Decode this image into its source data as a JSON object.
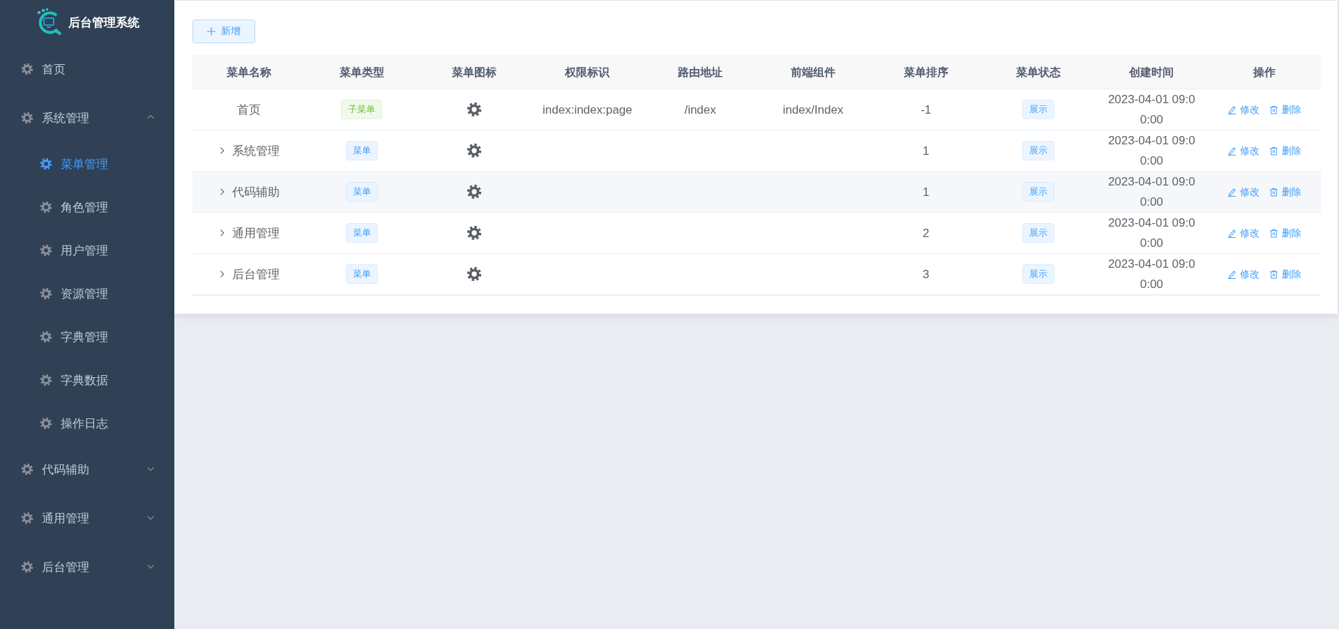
{
  "sidebar": {
    "title": "后台管理系统",
    "items": [
      {
        "label": "首页",
        "selected": false
      },
      {
        "label": "系统管理",
        "selected": false,
        "expanded": true,
        "children": [
          {
            "label": "菜单管理",
            "selected": true
          },
          {
            "label": "角色管理",
            "selected": false
          },
          {
            "label": "用户管理",
            "selected": false
          },
          {
            "label": "资源管理",
            "selected": false
          },
          {
            "label": "字典管理",
            "selected": false
          },
          {
            "label": "字典数据",
            "selected": false
          },
          {
            "label": "操作日志",
            "selected": false
          }
        ]
      },
      {
        "label": "代码辅助",
        "selected": false,
        "expanded": false
      },
      {
        "label": "通用管理",
        "selected": false,
        "expanded": false
      },
      {
        "label": "后台管理",
        "selected": false,
        "expanded": false
      }
    ]
  },
  "add_button": {
    "label": "新增"
  },
  "table": {
    "columns": [
      "菜单名称",
      "菜单类型",
      "菜单图标",
      "权限标识",
      "路由地址",
      "前端组件",
      "菜单排序",
      "菜单状态",
      "创建时间",
      "操作"
    ],
    "rows": [
      {
        "name": "首页",
        "expandable": false,
        "highlighted": false,
        "type": {
          "label": "子菜单",
          "kind": "success"
        },
        "permission": "index:index:page",
        "route": "/index",
        "component": "index/Index",
        "order": "-1",
        "status": "展示",
        "created": "2023-04-01 09:00:00",
        "actions": [
          "修改",
          "删除"
        ]
      },
      {
        "name": "系统管理",
        "expandable": true,
        "highlighted": false,
        "type": {
          "label": "菜单",
          "kind": "primary"
        },
        "order": "1",
        "status": "展示",
        "created": "2023-04-01 09:00:00",
        "actions": [
          "修改",
          "删除"
        ]
      },
      {
        "name": "代码辅助",
        "expandable": true,
        "highlighted": true,
        "type": {
          "label": "菜单",
          "kind": "primary"
        },
        "order": "1",
        "status": "展示",
        "created": "2023-04-01 09:00:00",
        "actions": [
          "修改",
          "删除"
        ]
      },
      {
        "name": "通用管理",
        "expandable": true,
        "highlighted": false,
        "type": {
          "label": "菜单",
          "kind": "primary"
        },
        "order": "2",
        "status": "展示",
        "created": "2023-04-01 09:00:00",
        "actions": [
          "修改",
          "删除"
        ]
      },
      {
        "name": "后台管理",
        "expandable": true,
        "highlighted": false,
        "type": {
          "label": "菜单",
          "kind": "primary"
        },
        "order": "3",
        "status": "展示",
        "created": "2023-04-01 09:00:00",
        "actions": [
          "修改",
          "删除"
        ]
      }
    ]
  }
}
